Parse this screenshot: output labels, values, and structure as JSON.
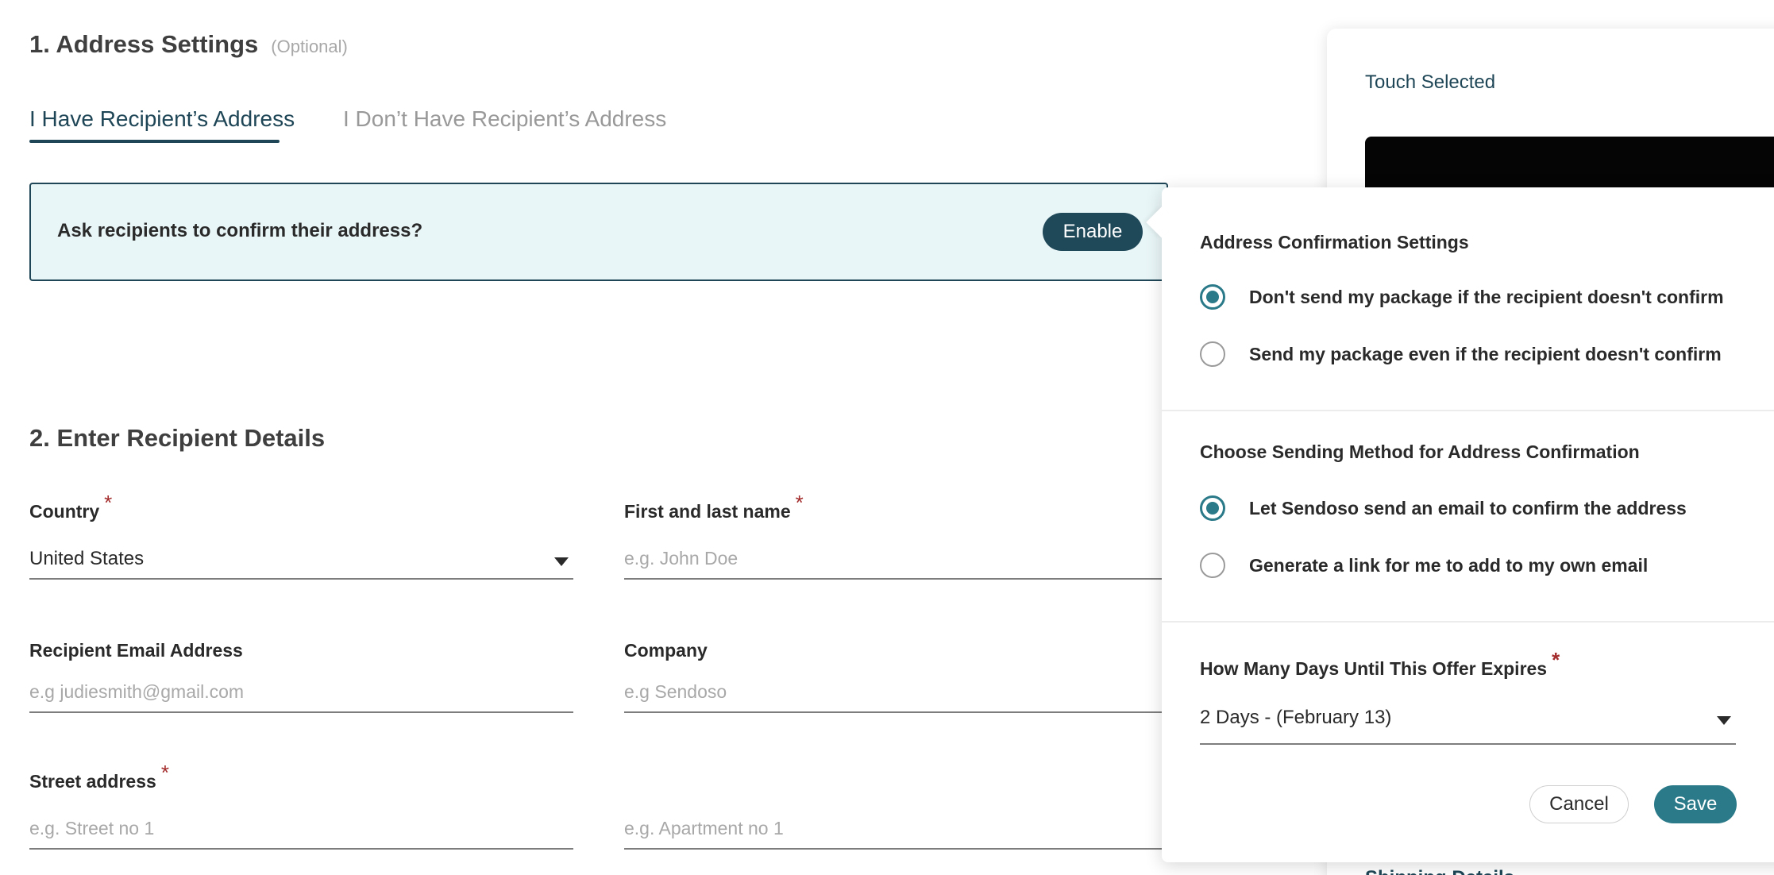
{
  "address_settings": {
    "title": "1. Address Settings",
    "optional": "(Optional)",
    "tabs": [
      {
        "label": "I Have Recipient’s Address",
        "active": true
      },
      {
        "label": "I Don’t Have Recipient’s Address",
        "active": false
      }
    ],
    "confirm_banner": {
      "question": "Ask recipients to confirm their address?",
      "enable_label": "Enable"
    }
  },
  "recipient_details": {
    "title": "2. Enter Recipient Details",
    "country": {
      "label": "Country",
      "required": "*",
      "value": "United States"
    },
    "name": {
      "label": "First and last name",
      "required": "*",
      "placeholder": "e.g. John Doe"
    },
    "email": {
      "label": "Recipient Email Address",
      "placeholder": "e.g judiesmith@gmail.com"
    },
    "company": {
      "label": "Company",
      "placeholder": "e.g Sendoso"
    },
    "street": {
      "label": "Street address",
      "required": "*",
      "placeholder": "e.g. Street no 1"
    },
    "apartment": {
      "placeholder": "e.g. Apartment no 1"
    }
  },
  "side_card": {
    "touch_label": "Touch Selected",
    "shipping_label": "Shipping Details"
  },
  "popover": {
    "confirmation_heading": "Address Confirmation Settings",
    "confirmation_options": [
      {
        "label": "Don't send my package if the recipient doesn't confirm",
        "checked": true
      },
      {
        "label": "Send my package even if the recipient doesn't confirm",
        "checked": false
      }
    ],
    "method_heading": "Choose Sending Method for Address Confirmation",
    "method_options": [
      {
        "label": "Let Sendoso send an email to confirm the address",
        "checked": true
      },
      {
        "label": "Generate a link for me to add to my own email",
        "checked": false
      }
    ],
    "expiry": {
      "label": "How Many Days Until This Offer Expires",
      "required": "*",
      "value": "2 Days - (February 13)"
    },
    "cancel_label": "Cancel",
    "save_label": "Save"
  },
  "colors": {
    "primary_dark": "#1e4656",
    "accent_teal": "#2a7a89",
    "banner_bg": "#e9f6f8",
    "required_red": "#a32b2b"
  }
}
